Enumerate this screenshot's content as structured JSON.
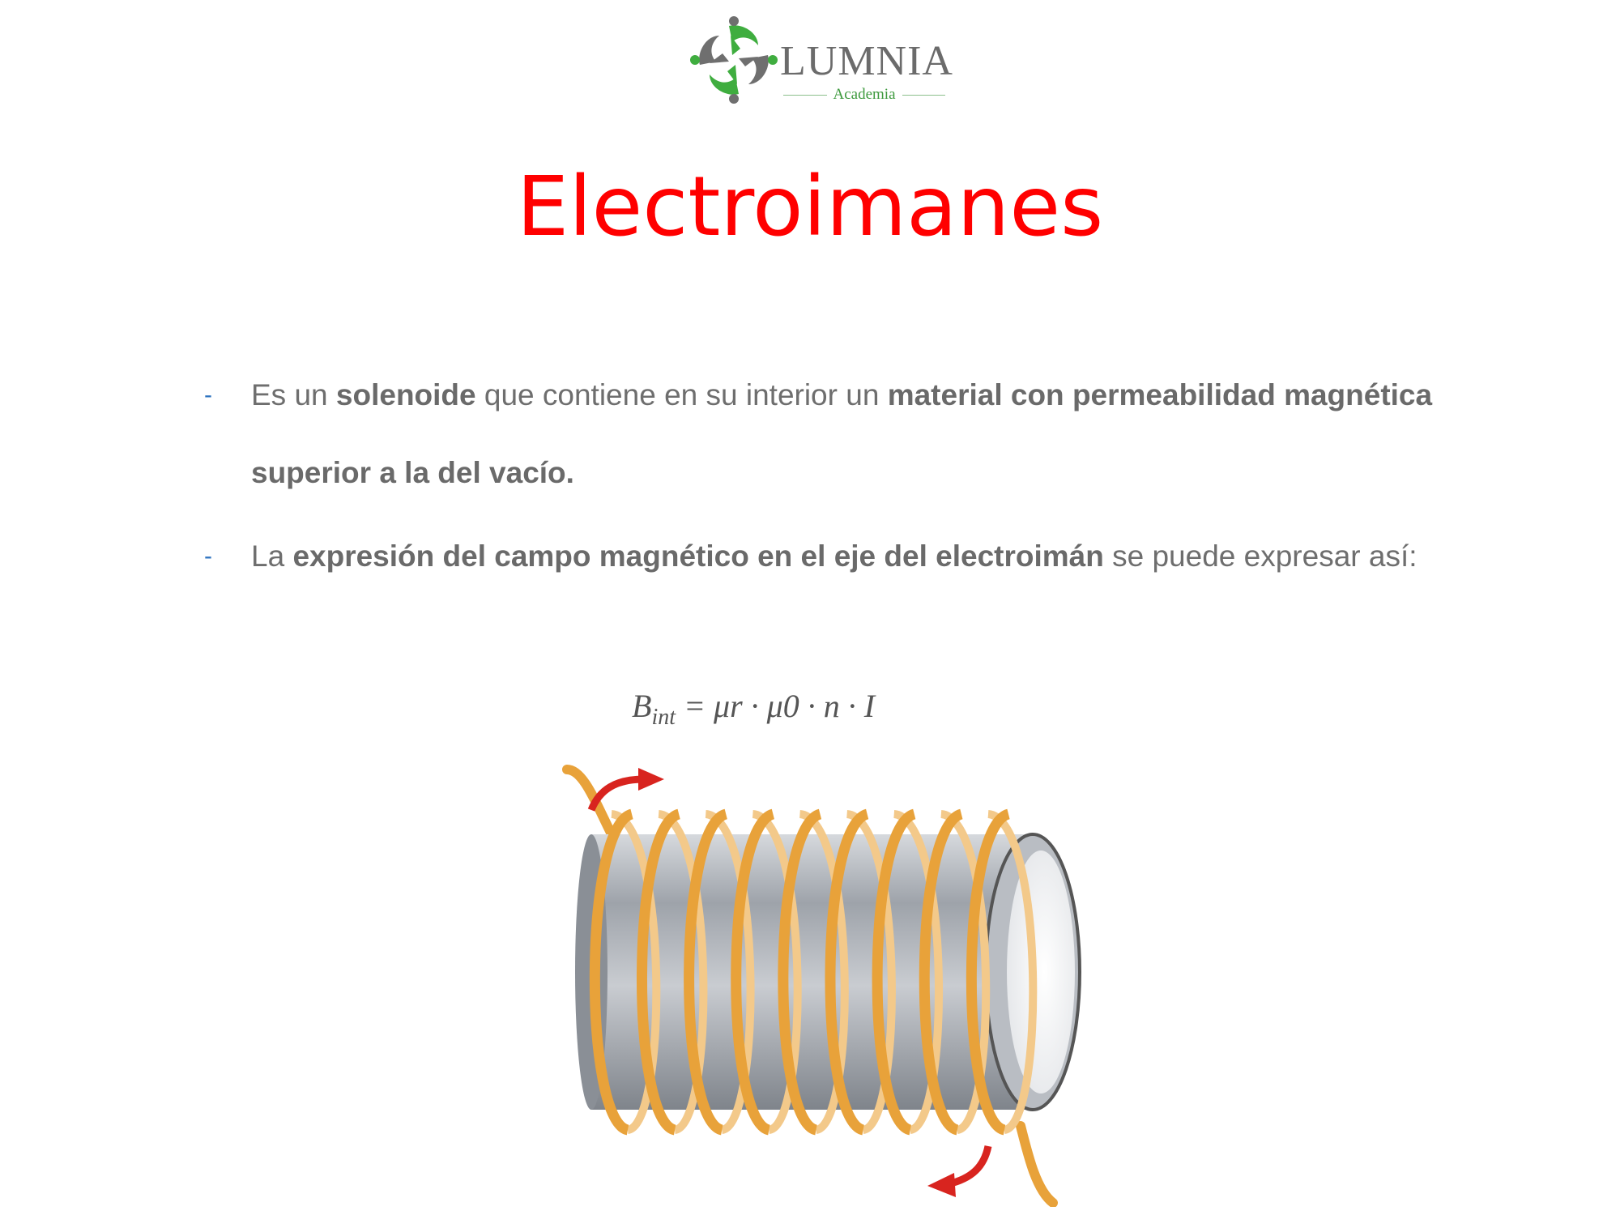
{
  "logo": {
    "name": "LUMNIA",
    "subtitle": "Academia",
    "icon": "people-circle-logo",
    "colors": {
      "green": "#3fad3f",
      "gray": "#6f6f6f"
    }
  },
  "slide": {
    "title": "Electroimanes",
    "title_color": "#ff0000",
    "bullet_marker": "-",
    "bullet_marker_color": "#2f74c0"
  },
  "bullets": [
    {
      "parts": [
        "Es un ",
        "solenoide",
        " que contiene en su interior un ",
        "material con permeabilidad magnética superior a la del vacío."
      ]
    },
    {
      "parts": [
        "La ",
        "expresión del campo magnético en el eje del electroimán",
        " se puede expresar así:"
      ]
    }
  ],
  "formula": {
    "lhs": "B",
    "lhs_subscript": "int",
    "rhs": "= μr · μ0 · n · I"
  },
  "illustration": {
    "subject": "solenoid-coil",
    "turns": 9,
    "colors": {
      "wire": "#e8a23a",
      "core": "#aeb3ba",
      "arrow": "#d8241f"
    }
  }
}
